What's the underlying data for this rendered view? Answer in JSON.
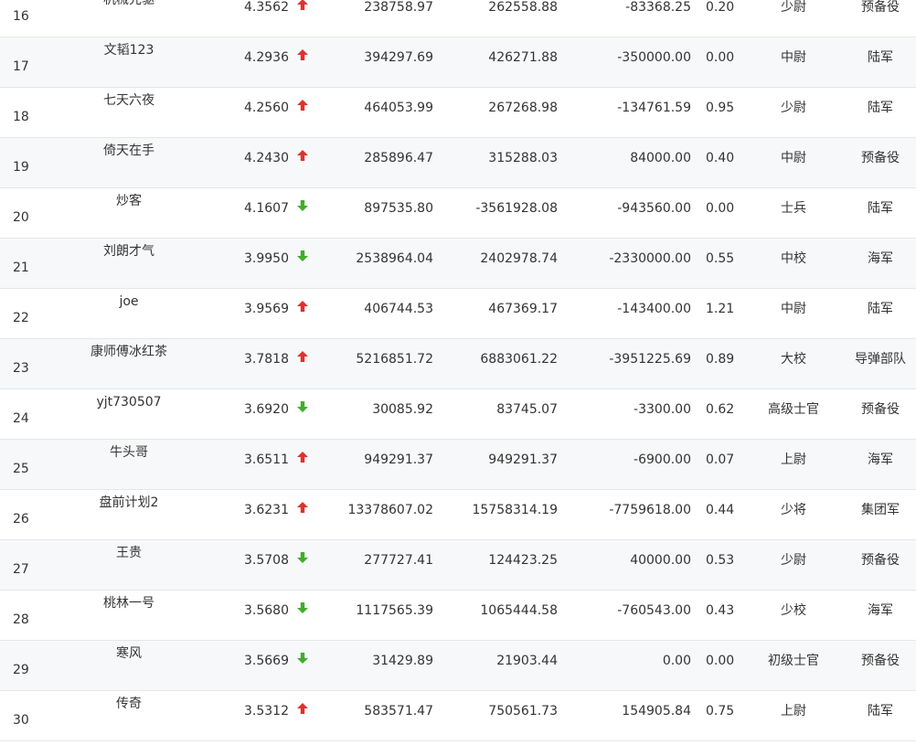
{
  "colors": {
    "up": "#e0312e",
    "down": "#3fae2a"
  },
  "rows": [
    {
      "rank": "16",
      "name": "机械先驱",
      "score": "4.3562",
      "trend": "up",
      "v1": "238758.97",
      "v2": "262558.88",
      "v3": "-83368.25",
      "ratio": "0.20",
      "rank_title": "少尉",
      "corps": "预备役"
    },
    {
      "rank": "17",
      "name": "文韬123",
      "score": "4.2936",
      "trend": "up",
      "v1": "394297.69",
      "v2": "426271.88",
      "v3": "-350000.00",
      "ratio": "0.00",
      "rank_title": "中尉",
      "corps": "陆军"
    },
    {
      "rank": "18",
      "name": "七天六夜",
      "score": "4.2560",
      "trend": "up",
      "v1": "464053.99",
      "v2": "267268.98",
      "v3": "-134761.59",
      "ratio": "0.95",
      "rank_title": "少尉",
      "corps": "陆军"
    },
    {
      "rank": "19",
      "name": "倚天在手",
      "score": "4.2430",
      "trend": "up",
      "v1": "285896.47",
      "v2": "315288.03",
      "v3": "84000.00",
      "ratio": "0.40",
      "rank_title": "中尉",
      "corps": "预备役"
    },
    {
      "rank": "20",
      "name": "炒客",
      "score": "4.1607",
      "trend": "down",
      "v1": "897535.80",
      "v2": "-3561928.08",
      "v3": "-943560.00",
      "ratio": "0.00",
      "rank_title": "士兵",
      "corps": "陆军"
    },
    {
      "rank": "21",
      "name": "刘朗才气",
      "score": "3.9950",
      "trend": "down",
      "v1": "2538964.04",
      "v2": "2402978.74",
      "v3": "-2330000.00",
      "ratio": "0.55",
      "rank_title": "中校",
      "corps": "海军"
    },
    {
      "rank": "22",
      "name": "joe",
      "score": "3.9569",
      "trend": "up",
      "v1": "406744.53",
      "v2": "467369.17",
      "v3": "-143400.00",
      "ratio": "1.21",
      "rank_title": "中尉",
      "corps": "陆军"
    },
    {
      "rank": "23",
      "name": "康师傅冰红茶",
      "score": "3.7818",
      "trend": "up",
      "v1": "5216851.72",
      "v2": "6883061.22",
      "v3": "-3951225.69",
      "ratio": "0.89",
      "rank_title": "大校",
      "corps": "导弹部队"
    },
    {
      "rank": "24",
      "name": "yjt730507",
      "score": "3.6920",
      "trend": "down",
      "v1": "30085.92",
      "v2": "83745.07",
      "v3": "-3300.00",
      "ratio": "0.62",
      "rank_title": "高级士官",
      "corps": "预备役"
    },
    {
      "rank": "25",
      "name": "牛头哥",
      "score": "3.6511",
      "trend": "up",
      "v1": "949291.37",
      "v2": "949291.37",
      "v3": "-6900.00",
      "ratio": "0.07",
      "rank_title": "上尉",
      "corps": "海军"
    },
    {
      "rank": "26",
      "name": "盘前计划2",
      "score": "3.6231",
      "trend": "up",
      "v1": "13378607.02",
      "v2": "15758314.19",
      "v3": "-7759618.00",
      "ratio": "0.44",
      "rank_title": "少将",
      "corps": "集团军"
    },
    {
      "rank": "27",
      "name": "王贵",
      "score": "3.5708",
      "trend": "down",
      "v1": "277727.41",
      "v2": "124423.25",
      "v3": "40000.00",
      "ratio": "0.53",
      "rank_title": "少尉",
      "corps": "预备役"
    },
    {
      "rank": "28",
      "name": "桃林一号",
      "score": "3.5680",
      "trend": "down",
      "v1": "1117565.39",
      "v2": "1065444.58",
      "v3": "-760543.00",
      "ratio": "0.43",
      "rank_title": "少校",
      "corps": "海军"
    },
    {
      "rank": "29",
      "name": "寒风",
      "score": "3.5669",
      "trend": "down",
      "v1": "31429.89",
      "v2": "21903.44",
      "v3": "0.00",
      "ratio": "0.00",
      "rank_title": "初级士官",
      "corps": "预备役"
    },
    {
      "rank": "30",
      "name": "传奇",
      "score": "3.5312",
      "trend": "up",
      "v1": "583571.47",
      "v2": "750561.73",
      "v3": "154905.84",
      "ratio": "0.75",
      "rank_title": "上尉",
      "corps": "陆军"
    }
  ]
}
